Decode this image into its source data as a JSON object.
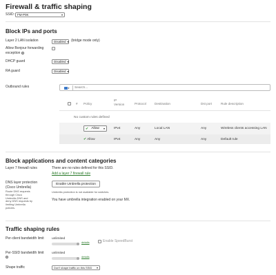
{
  "page": {
    "title": "Firewall & traffic shaping"
  },
  "ssid": {
    "label": "SSID:",
    "value": "FM-P0K"
  },
  "block_ips": {
    "heading": "Block IPs and ports",
    "layer2": {
      "label": "Layer 2 LAN isolation",
      "value": "Disabled",
      "note": "(bridge mode only)"
    },
    "bonjour": {
      "label": "Allow Bonjour forwarding exception"
    },
    "dhcp": {
      "label": "DHCP guard",
      "value": "Disabled"
    },
    "ra": {
      "label": "RA guard",
      "value": "Disabled"
    },
    "outbound": {
      "label": "Outbound rules",
      "search_placeholder": "Search...",
      "columns": [
        "#",
        "Policy",
        "IP Version",
        "Protocol",
        "Destination",
        "Dst port",
        "Rule description"
      ],
      "empty_text": "No custom rules defined",
      "rows": [
        {
          "policy": "Allow",
          "ipver": "IPv4",
          "protocol": "Any",
          "destination": "Local LAN",
          "dst_port": "Any",
          "description": "Wireless clients accessing LAN"
        },
        {
          "policy": "Allow",
          "ipver": "IPv4",
          "protocol": "Any",
          "destination": "Any",
          "dst_port": "Any",
          "description": "Default rule"
        }
      ]
    }
  },
  "block_apps": {
    "heading": "Block applications and content categories",
    "l7": {
      "label": "Layer 7 firewall rules",
      "text": "There are no rules defined for this SSID.",
      "link": "Add a layer 7 firewall rule"
    },
    "dns": {
      "label": "DNS layer protection (Cisco Umbrella)",
      "description": "Route DNS requests through Cisco Umbrella DNS and deny DNS requests by limiting Umbrella policies.",
      "button": "Enable Umbrella protection",
      "unavailable": "Umbrella protection is not available for switches.",
      "status": "You have umbrella integration enabled on your MX."
    }
  },
  "traffic": {
    "heading": "Traffic shaping rules",
    "per_client": {
      "label": "Per-client bandwidth limit",
      "value": "unlimited",
      "details": "details",
      "speedburst": "Enable SpeedBurst"
    },
    "per_ssid": {
      "label": "Per-SSID bandwidth limit",
      "value": "unlimited",
      "details": "details"
    },
    "shape": {
      "label": "Shape traffic",
      "value": "Don't shape traffic on this SSID"
    }
  },
  "colors": {
    "allow_green": "#2f8f2f",
    "link_green": "#2a7a2a",
    "filter_blue": "#3a78c9"
  }
}
